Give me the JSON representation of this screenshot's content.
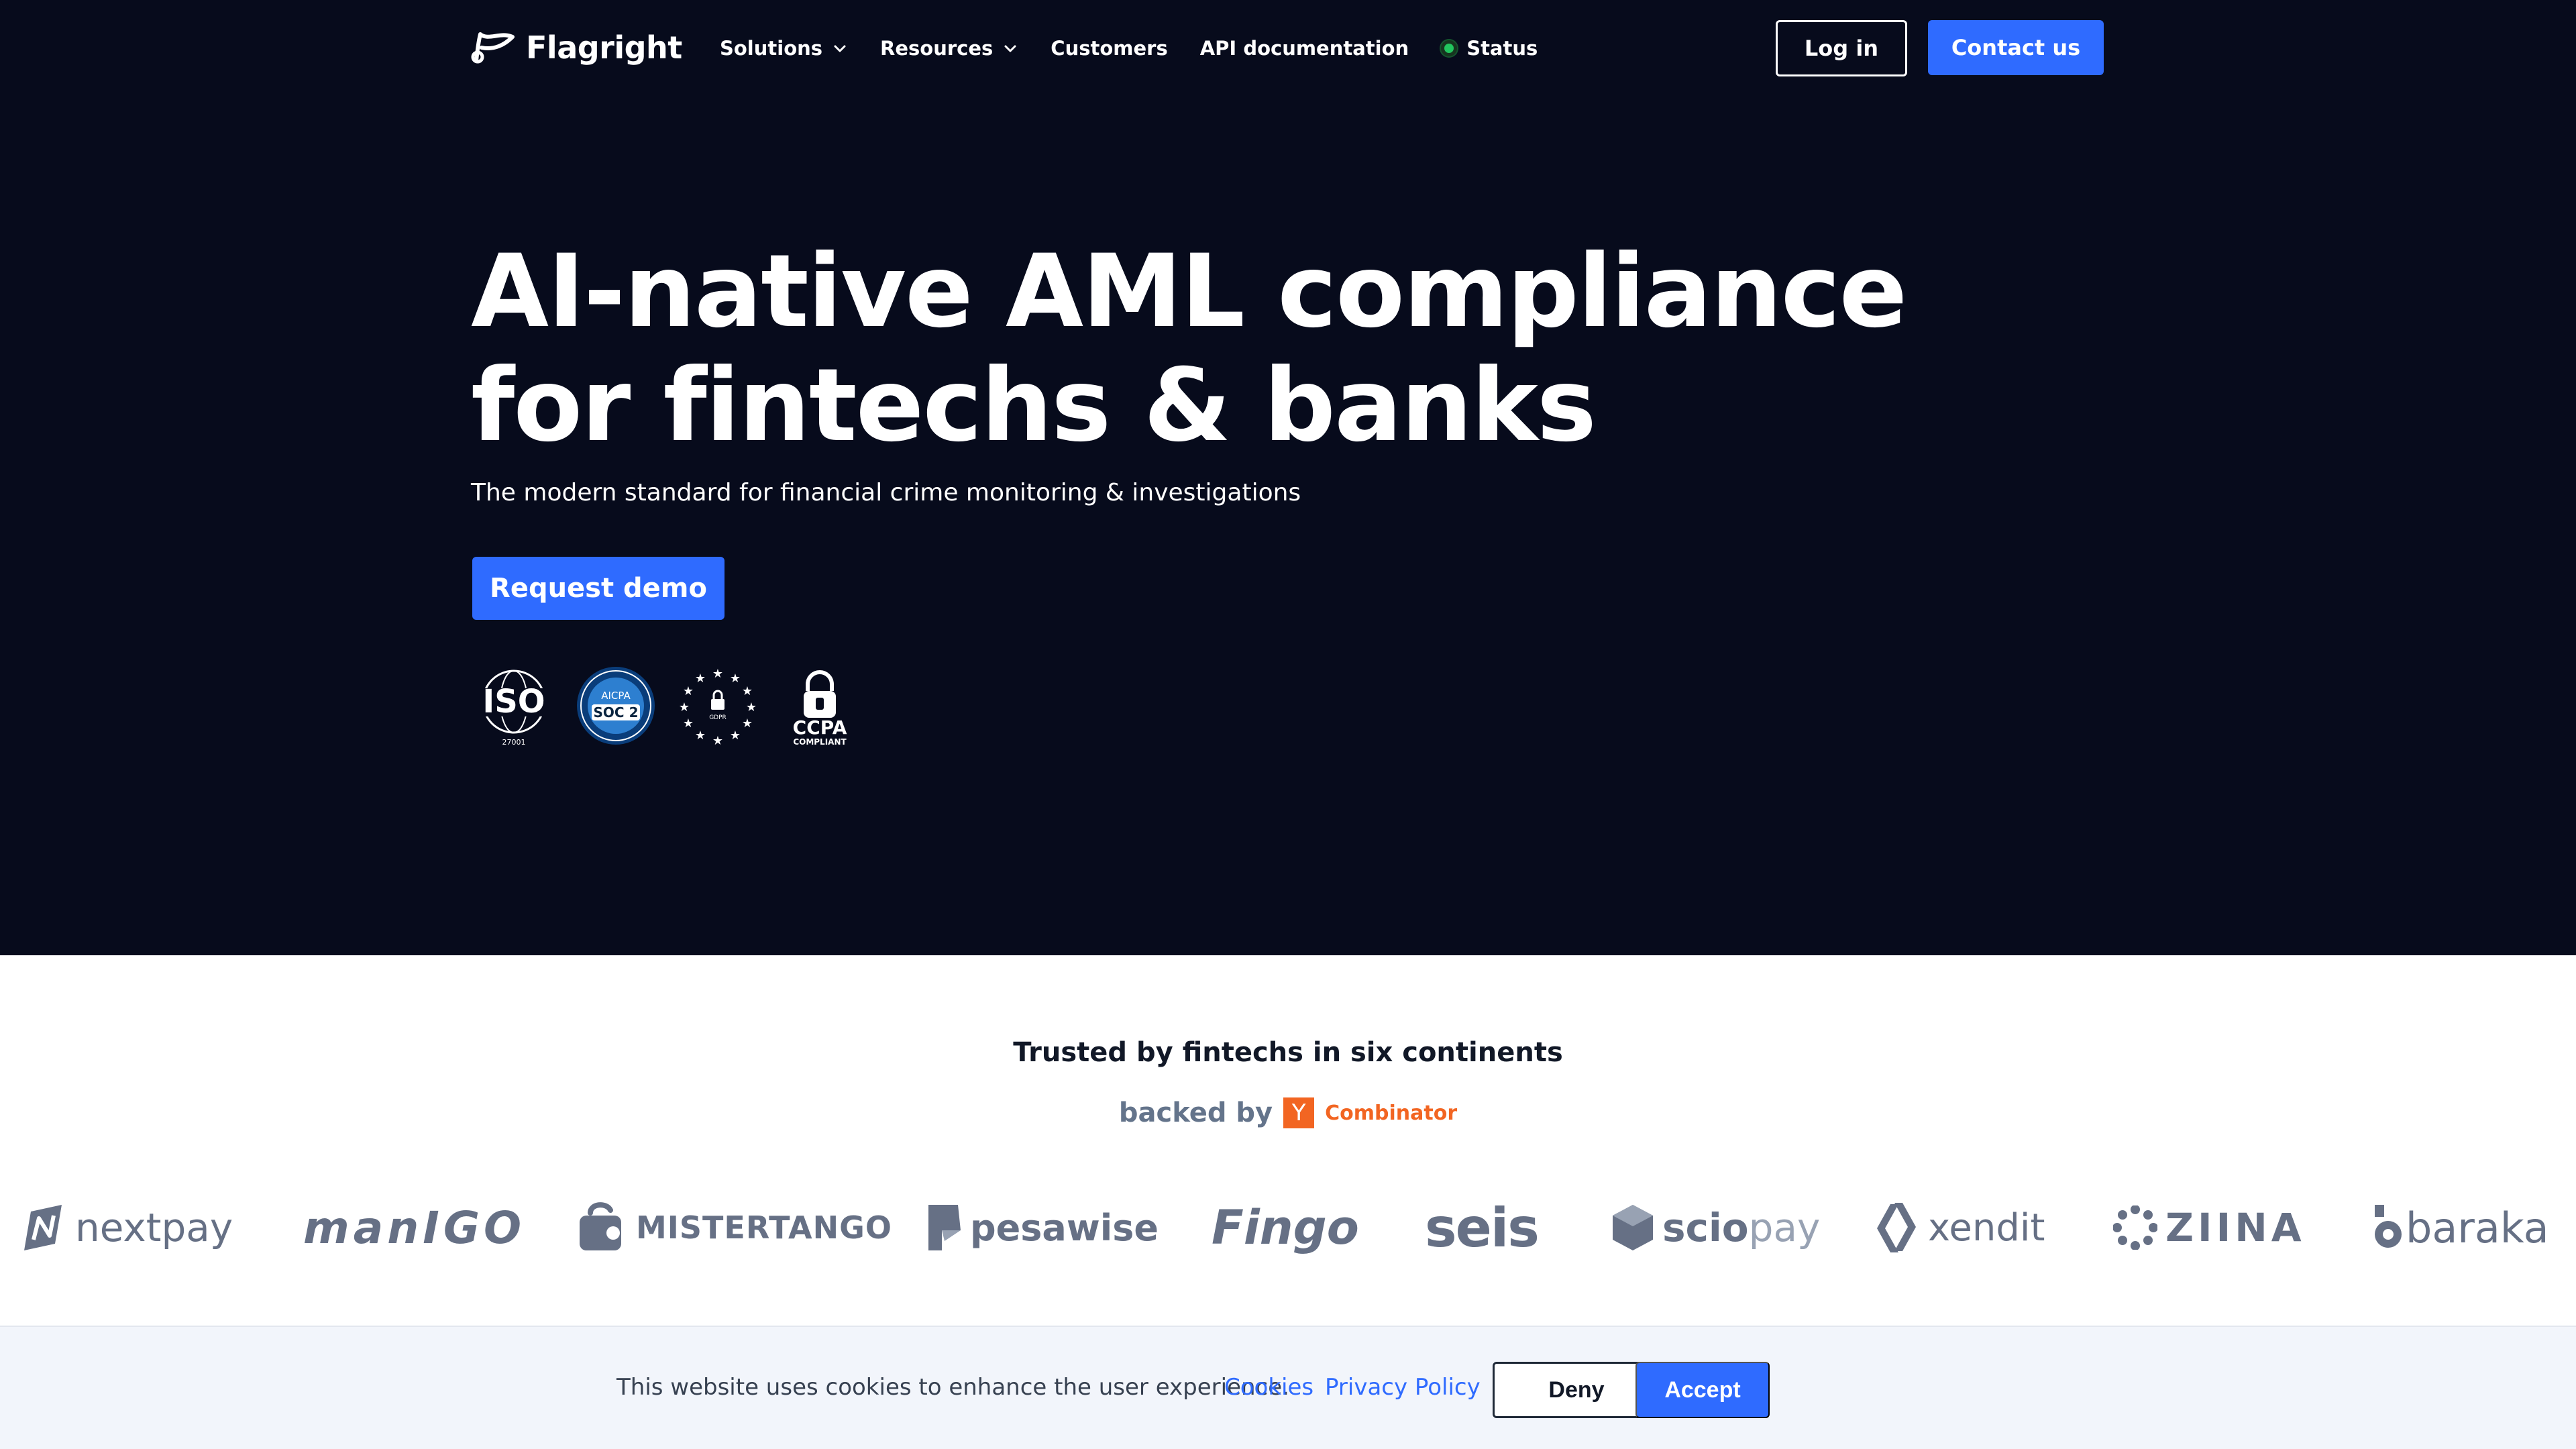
{
  "header": {
    "brand": "Flagright",
    "nav": [
      {
        "label": "Solutions",
        "has_dropdown": true
      },
      {
        "label": "Resources",
        "has_dropdown": true
      },
      {
        "label": "Customers",
        "has_dropdown": false
      },
      {
        "label": "API documentation",
        "has_dropdown": false
      },
      {
        "label": "Status",
        "has_status_dot": true
      }
    ],
    "login_label": "Log in",
    "contact_label": "Contact us"
  },
  "hero": {
    "headline_line1": "AI-native AML compliance",
    "headline_line2": "for fintechs & banks",
    "subheadline": "The modern standard for financial crime monitoring & investigations",
    "cta_label": "Request demo",
    "badges": {
      "iso": {
        "title": "ISO",
        "sub": "27001"
      },
      "soc": {
        "top": "AICPA",
        "main": "SOC 2"
      },
      "gdpr": {
        "label": "GDPR"
      },
      "ccpa": {
        "title": "CCPA",
        "sub": "COMPLIANT"
      }
    }
  },
  "trust": {
    "heading": "Trusted by fintechs in six continents",
    "backed_label": "backed by",
    "yc_letter": "Y",
    "yc_name": "Combinator",
    "clients": {
      "nextpay": "nextpay",
      "manigo": "manIGO",
      "mistertango": "MISTERTANGO",
      "pesawise": "pesawise",
      "fingo": "Fingo",
      "seis": "seis",
      "sciopay_bold": "scio",
      "sciopay_light": "pay",
      "xendit": "xendit",
      "ziina": "ZIINA",
      "baraka": "baraka"
    }
  },
  "cookie": {
    "message": "This website uses cookies to enhance the user experience.",
    "cookies_link": "Cookies",
    "privacy_link": "Privacy Policy",
    "deny_label": "Deny",
    "accept_label": "Accept"
  },
  "colors": {
    "hero_bg": "#070b1c",
    "accent": "#2f6bff",
    "status_green": "#22c55e",
    "yc_orange": "#f26522",
    "logo_gray": "#667085"
  },
  "icons": [
    "flagright-logo-icon",
    "chevron-down-icon",
    "status-dot-icon",
    "iso-badge-icon",
    "soc2-badge-icon",
    "gdpr-badge-icon",
    "ccpa-badge-icon"
  ]
}
